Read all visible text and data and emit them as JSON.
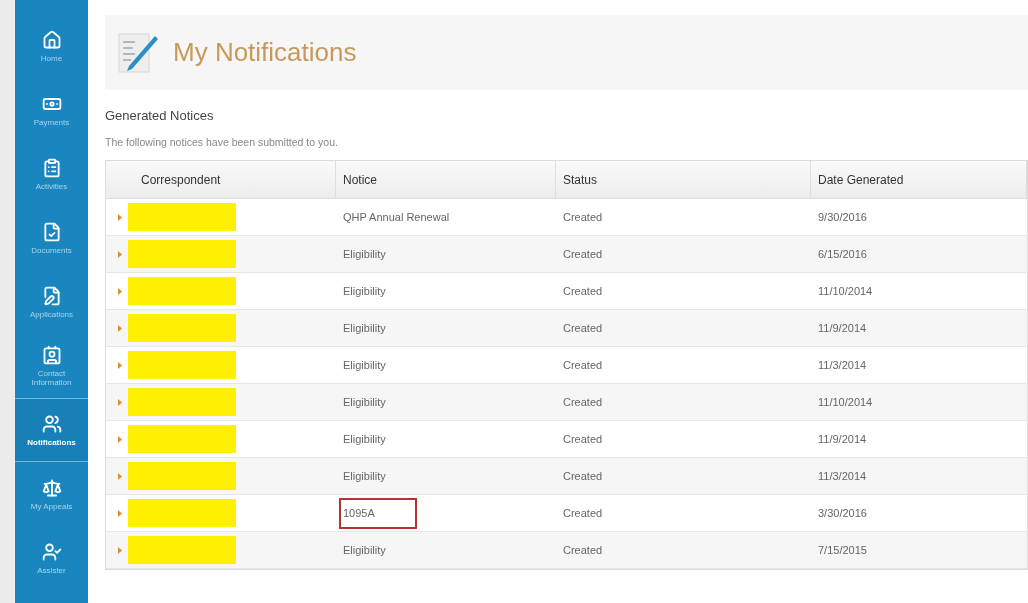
{
  "sidebar": {
    "items": [
      {
        "label": "Home",
        "selected": false
      },
      {
        "label": "Payments",
        "selected": false
      },
      {
        "label": "Activities",
        "selected": false
      },
      {
        "label": "Documents",
        "selected": false
      },
      {
        "label": "Applications",
        "selected": false
      },
      {
        "label": "Contact Information",
        "selected": false
      },
      {
        "label": "Notifications",
        "selected": true
      },
      {
        "label": "My Appeals",
        "selected": false
      },
      {
        "label": "Assister",
        "selected": false
      }
    ]
  },
  "page": {
    "title": "My Notifications",
    "section": "Generated Notices",
    "intro": "The following notices have been submitted to you."
  },
  "table": {
    "columns": [
      "Correspondent",
      "Notice",
      "Status",
      "Date Generated"
    ],
    "rows": [
      {
        "redacted": true,
        "notice": "QHP Annual Renewal",
        "status": "Created",
        "date": "9/30/2016",
        "highlighted": false
      },
      {
        "redacted": true,
        "notice": "Eligibility",
        "status": "Created",
        "date": "6/15/2016",
        "highlighted": false
      },
      {
        "redacted": true,
        "notice": "Eligibility",
        "status": "Created",
        "date": "11/10/2014",
        "highlighted": false
      },
      {
        "redacted": true,
        "notice": "Eligibility",
        "status": "Created",
        "date": "11/9/2014",
        "highlighted": false
      },
      {
        "redacted": true,
        "notice": "Eligibility",
        "status": "Created",
        "date": "11/3/2014",
        "highlighted": false
      },
      {
        "redacted": true,
        "notice": "Eligibility",
        "status": "Created",
        "date": "11/10/2014",
        "highlighted": false
      },
      {
        "redacted": true,
        "notice": "Eligibility",
        "status": "Created",
        "date": "11/9/2014",
        "highlighted": false
      },
      {
        "redacted": true,
        "notice": "Eligibility",
        "status": "Created",
        "date": "11/3/2014",
        "highlighted": false
      },
      {
        "redacted": true,
        "notice": "1095A",
        "status": "Created",
        "date": "3/30/2016",
        "highlighted": true
      },
      {
        "redacted": true,
        "notice": "Eligibility",
        "status": "Created",
        "date": "7/15/2015",
        "highlighted": false
      }
    ]
  }
}
